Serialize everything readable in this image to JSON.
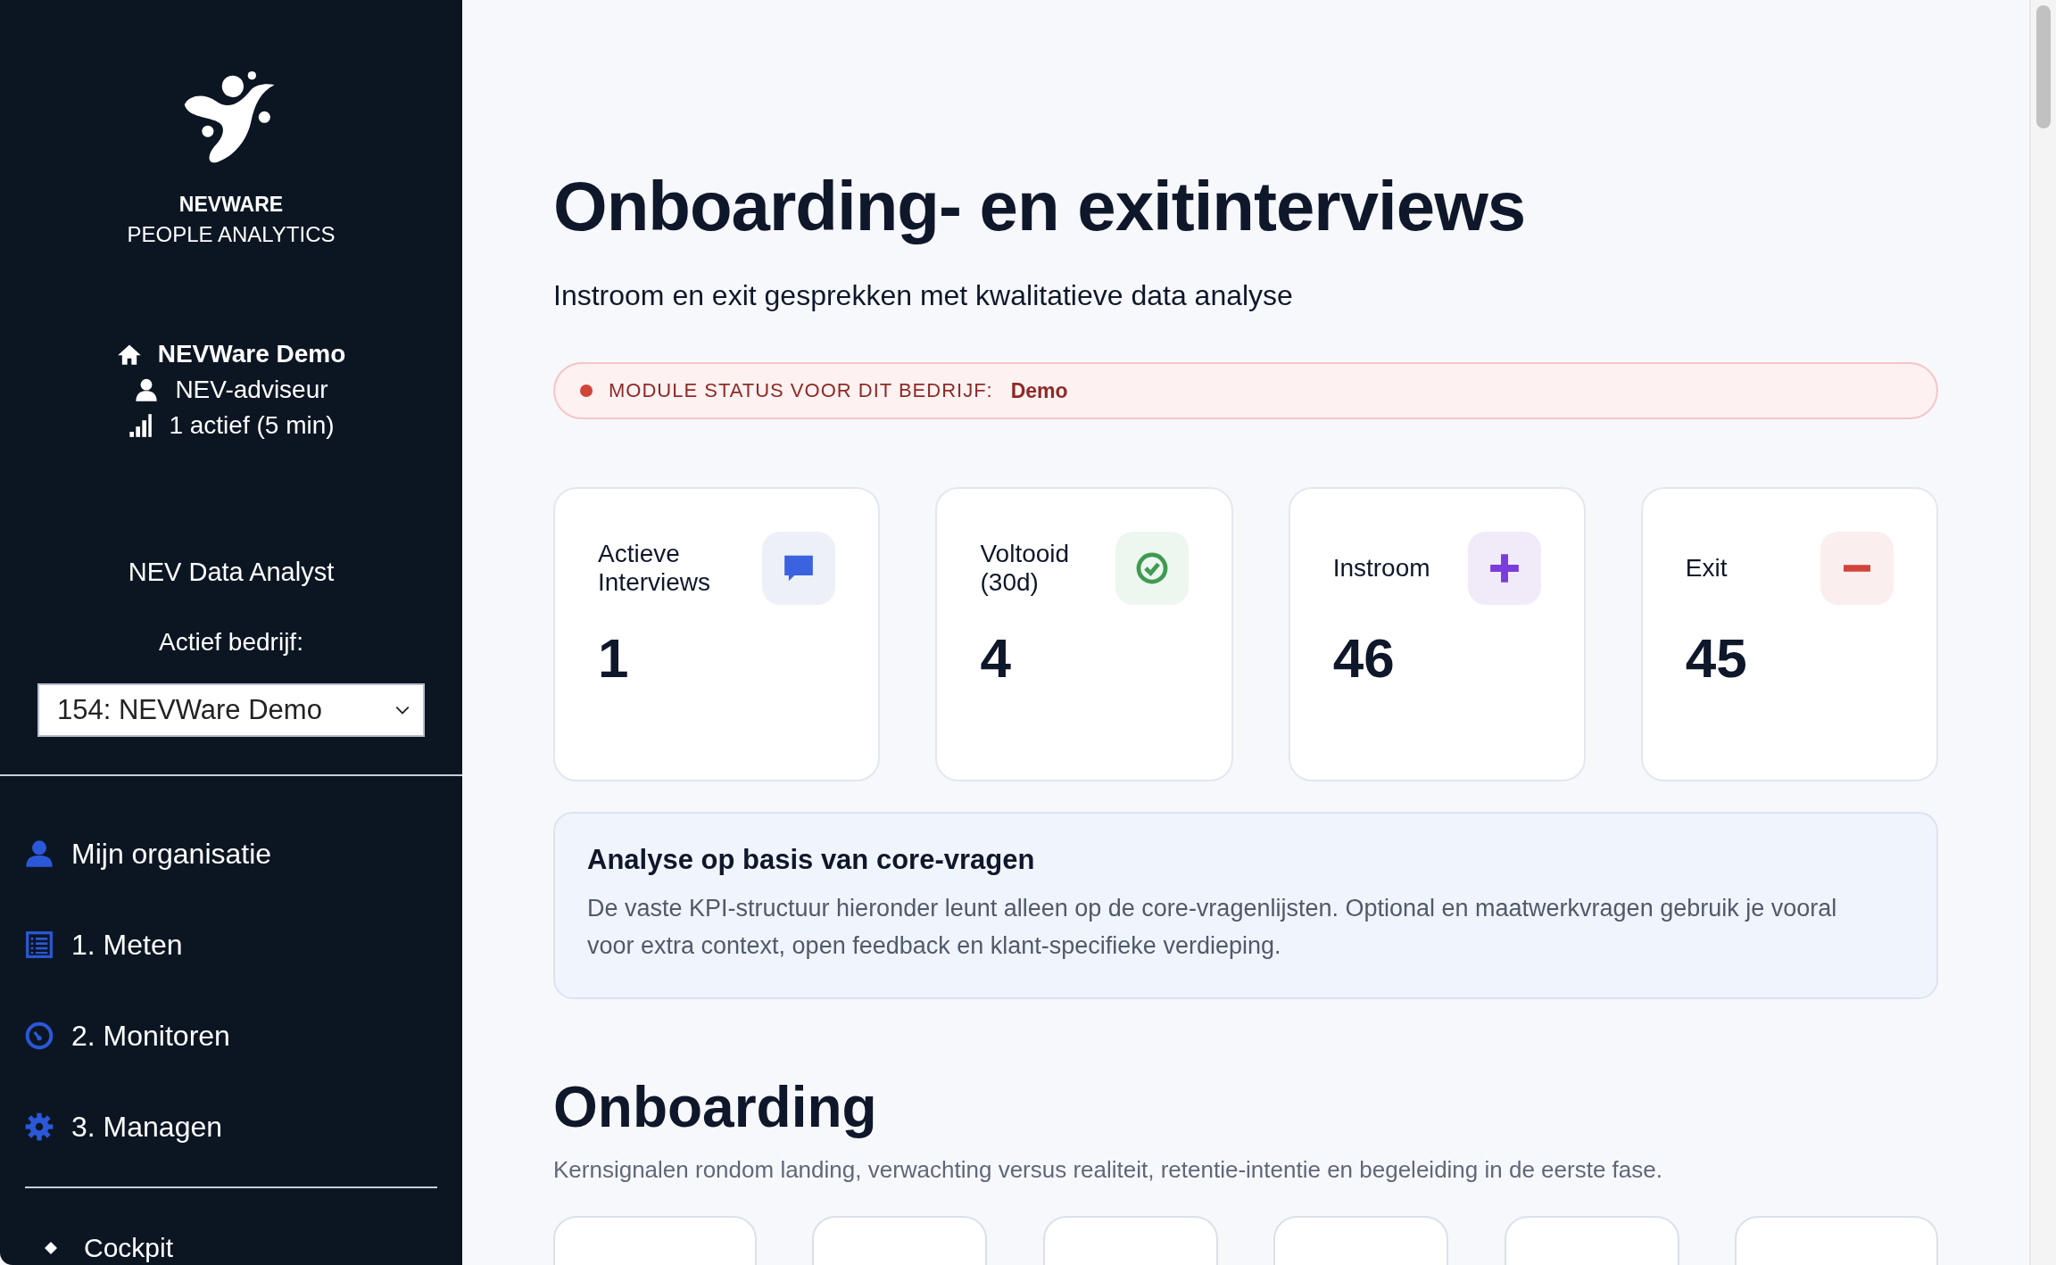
{
  "sidebar": {
    "brand": {
      "name": "NEVWARE",
      "tagline": "PEOPLE ANALYTICS"
    },
    "info": [
      {
        "kind": "company",
        "text": "NEVWare Demo"
      },
      {
        "kind": "user",
        "text": "NEV-adviseur"
      },
      {
        "kind": "active",
        "text": "1 actief (5 min)"
      }
    ],
    "role": "NEV Data Analyst",
    "company_label": "Actief bedrijf:",
    "company_select": {
      "value": "154: NEVWare Demo"
    },
    "nav": [
      {
        "kind": "person",
        "label": "Mijn organisatie"
      },
      {
        "kind": "list",
        "label": "1. Meten"
      },
      {
        "kind": "gauge",
        "label": "2. Monitoren"
      },
      {
        "kind": "gear",
        "label": "3. Managen"
      }
    ],
    "subnav": [
      {
        "label": "Cockpit"
      }
    ]
  },
  "page": {
    "title": "Onboarding- en exitinterviews",
    "subtitle": "Instroom en exit gesprekken met kwalitatieve data analyse",
    "module_status": {
      "label": "MODULE STATUS VOOR DIT BEDRIJF:",
      "value": "Demo"
    },
    "stats": [
      {
        "kind": "chat",
        "label": "Actieve Interviews",
        "value": "1"
      },
      {
        "kind": "check",
        "label": "Voltooid (30d)",
        "value": "4"
      },
      {
        "kind": "plus",
        "label": "Instroom",
        "value": "46"
      },
      {
        "kind": "minus",
        "label": "Exit",
        "value": "45"
      }
    ],
    "notice": {
      "title": "Analyse op basis van core-vragen",
      "text": "De vaste KPI-structuur hieronder leunt alleen op de core-vragenlijsten. Optional en maatwerkvragen gebruik je vooral voor extra context, open feedback en klant-specifieke verdieping."
    },
    "section": {
      "title": "Onboarding",
      "description": "Kernsignalen rondom landing, verwachting versus realiteit, retentie-intentie en begeleiding in de eerste fase."
    }
  }
}
